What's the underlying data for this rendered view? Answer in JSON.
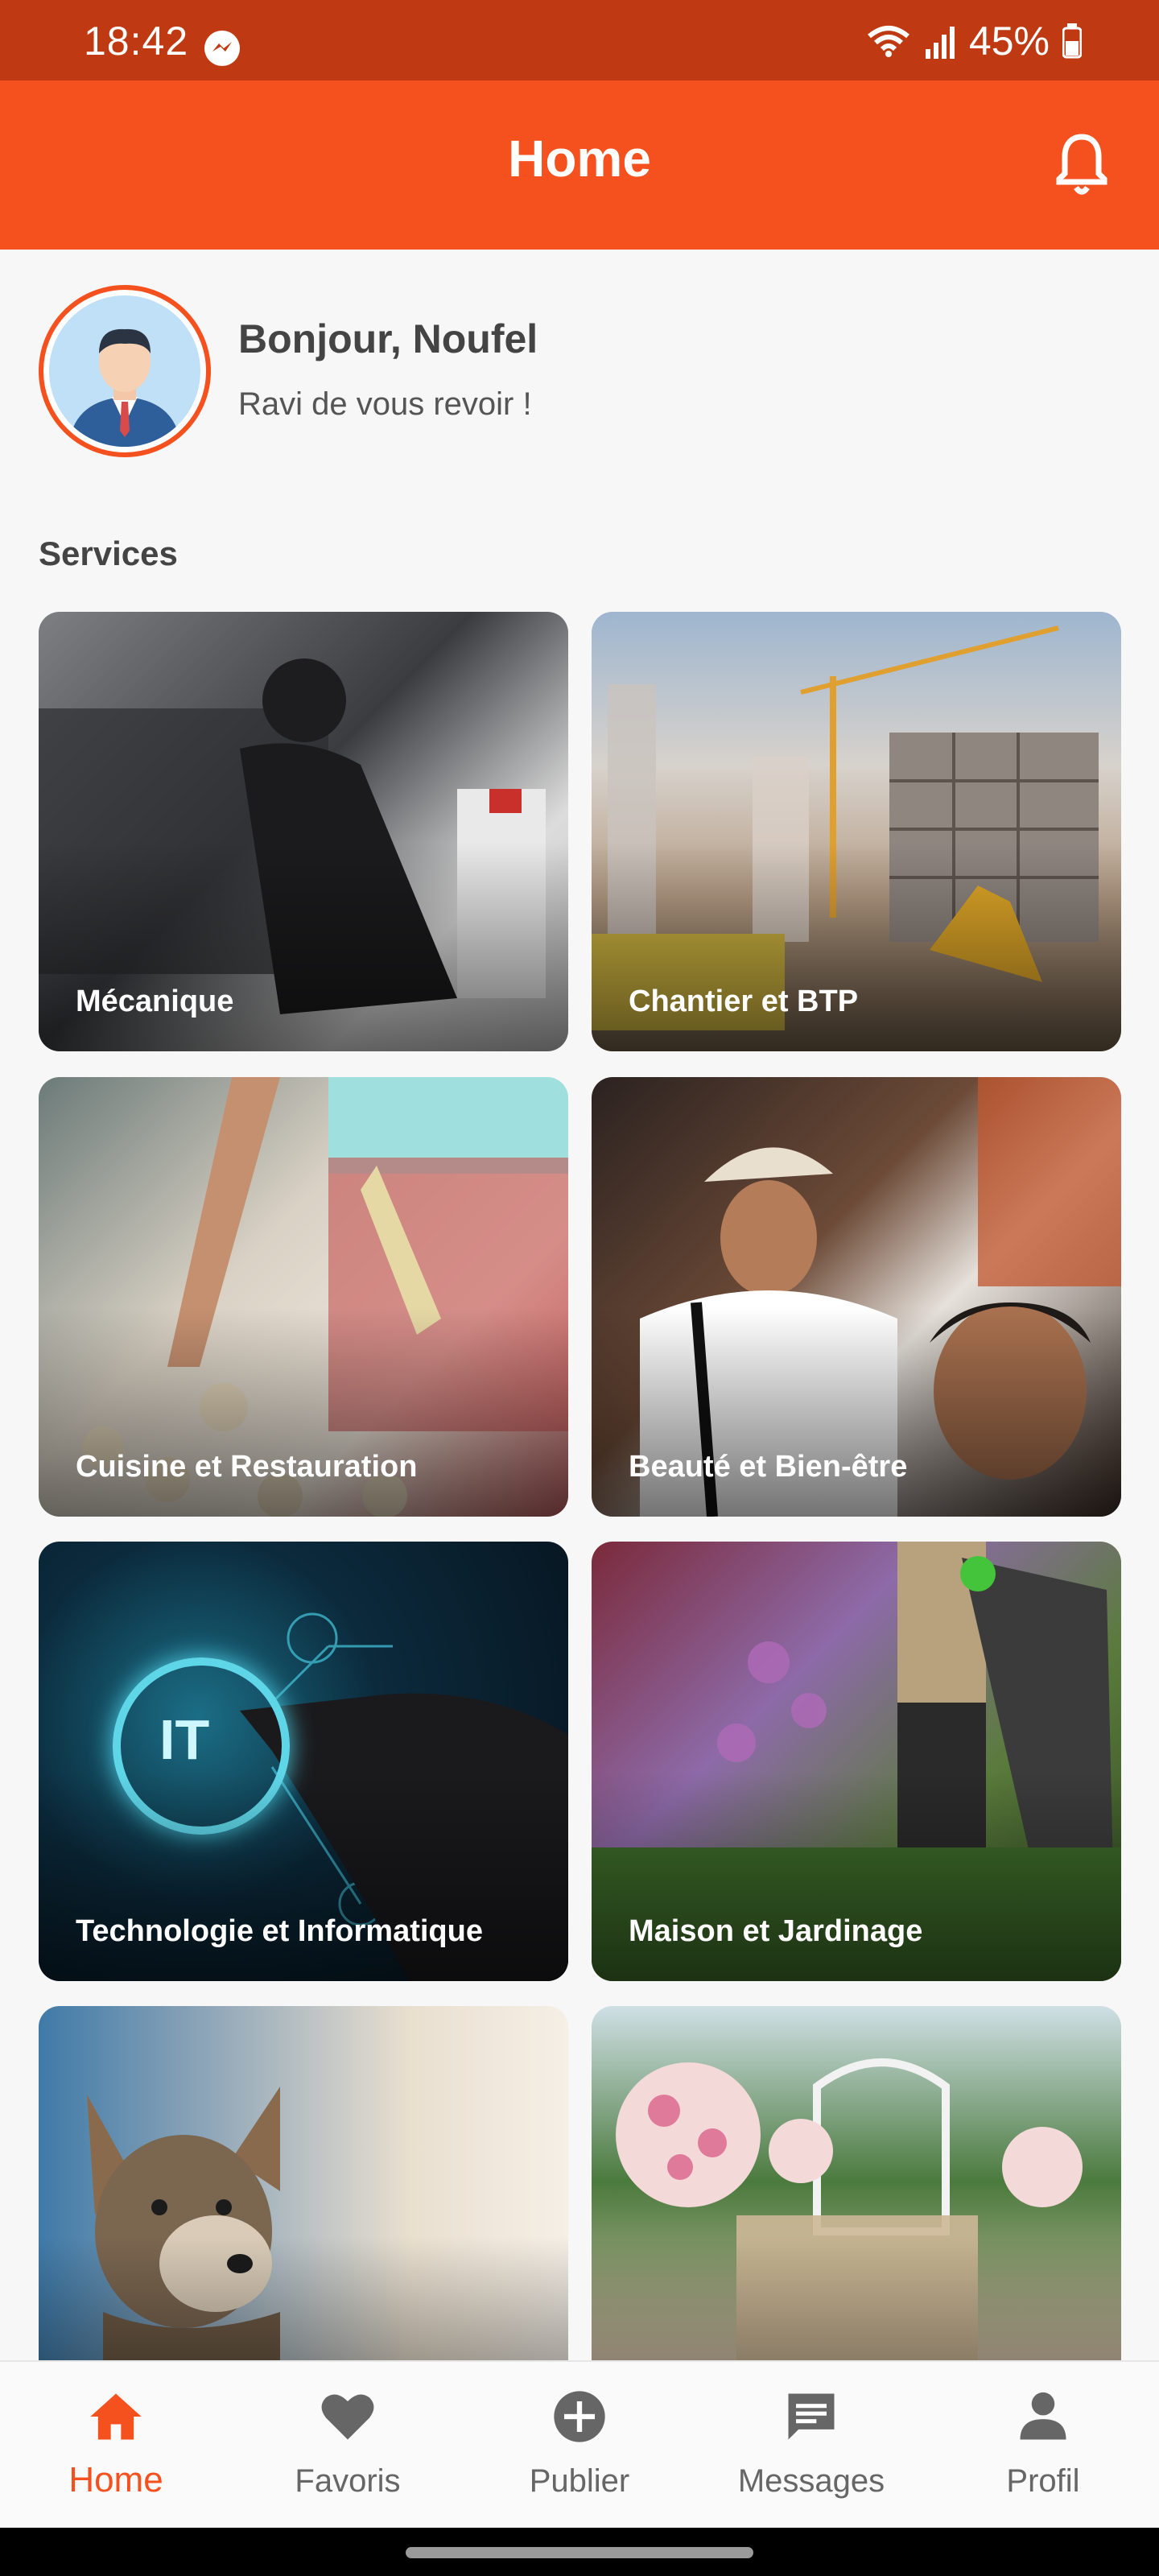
{
  "status_bar": {
    "time": "18:42",
    "battery": "45%"
  },
  "app_bar": {
    "title": "Home",
    "bell_icon": "bell-icon"
  },
  "greeting": {
    "title": "Bonjour, Noufel",
    "subtitle": "Ravi de vous revoir !"
  },
  "services": {
    "title": "Services",
    "items": [
      {
        "label": "Mécanique"
      },
      {
        "label": "Chantier et BTP"
      },
      {
        "label": "Cuisine et Restauration"
      },
      {
        "label": "Beauté et Bien-être"
      },
      {
        "label": "Technologie et Informatique"
      },
      {
        "label": "Maison et Jardinage"
      },
      {
        "label": ""
      },
      {
        "label": ""
      }
    ]
  },
  "bottom_nav": {
    "items": [
      {
        "label": "Home",
        "icon": "home-icon",
        "active": true
      },
      {
        "label": "Favoris",
        "icon": "heart-icon",
        "active": false
      },
      {
        "label": "Publier",
        "icon": "add-circle-icon",
        "active": false
      },
      {
        "label": "Messages",
        "icon": "chat-icon",
        "active": false
      },
      {
        "label": "Profil",
        "icon": "person-icon",
        "active": false
      }
    ]
  },
  "colors": {
    "primary": "#f4511e",
    "status_bar": "#bf3a12",
    "inactive": "#666666"
  }
}
